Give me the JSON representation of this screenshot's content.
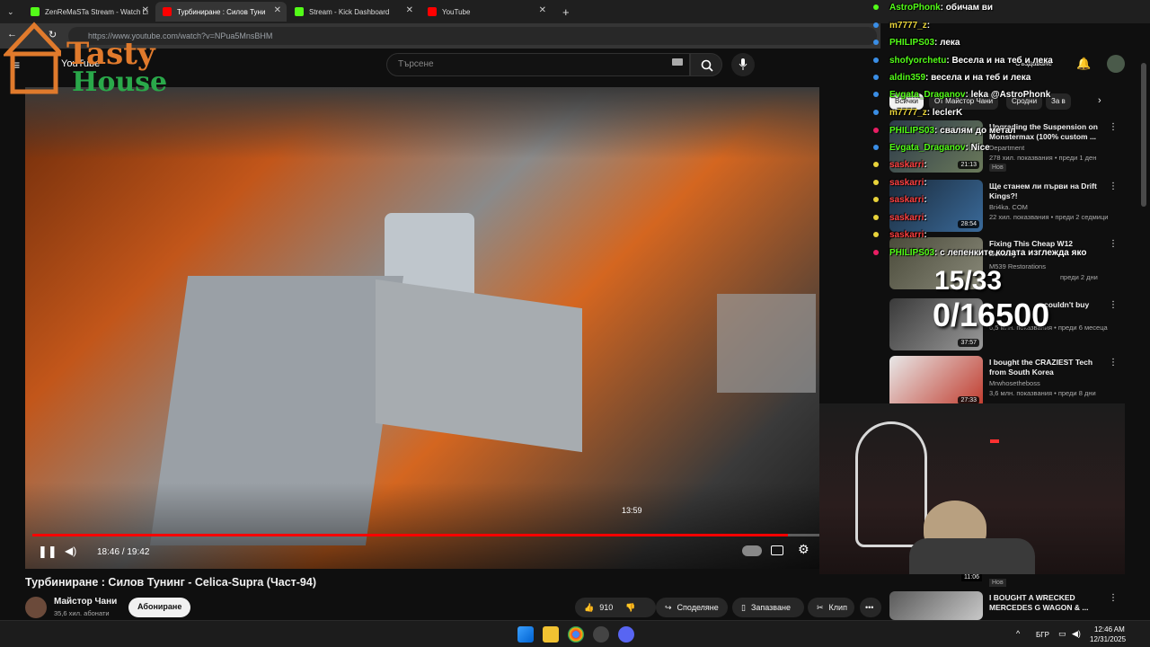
{
  "browser": {
    "tabs": [
      {
        "label": "ZenReMaSTa Stream - Watch Li",
        "color": "#53fc18"
      },
      {
        "label": "Турбиниране : Силов Туни",
        "color": "#ff0000"
      },
      {
        "label": "Stream - Kick Dashboard",
        "color": "#53fc18"
      },
      {
        "label": "YouTube",
        "color": "#ff0000"
      }
    ],
    "url": "https://www.youtube.com/watch?v=NPua5MnsBHM"
  },
  "youtube": {
    "logo_text": "YouTube",
    "search_placeholder": "Търсене",
    "create_label": "Създаване"
  },
  "overlay_logo": {
    "tasty": "Tasty",
    "house": "House"
  },
  "player": {
    "current_time": "18:46 / 19:42",
    "hover_time": "13:59",
    "progress": 0.96
  },
  "video": {
    "title": "Турбиниране : Силов Тунинг - Celica-Supra (Част-94)",
    "channel": "Майстор Чани",
    "subscribers": "35,6 хил. абонати",
    "subscribe_label": "Абониране",
    "likes": "910",
    "share_label": "Споделяне",
    "save_label": "Запазване",
    "clip_label": "Клип"
  },
  "filters": [
    "Всички",
    "От Майстор Чани",
    "Сродни",
    "За в"
  ],
  "recommendations": [
    {
      "title": "Upgrading the Suspension on Monstermax (100% custom ...",
      "channel": "Department",
      "meta": "278 хил. показвания • преди 1 ден",
      "duration": "21:13",
      "badge": "Нов"
    },
    {
      "title": "Ще станем ли първи на Drift Kings?!",
      "channel": "Bri4ka. COM",
      "meta": "22 хил. показвания • преди 2 седмици",
      "duration": "28:54",
      "badge": ""
    },
    {
      "title": "Fixing This Cheap W12 Bentley",
      "channel": "M539 Restorations",
      "meta": "преди 2 дни",
      "duration": "",
      "badge": ""
    },
    {
      "title": "couldn't buy",
      "channel": "",
      "meta": "6,5 млн. показвания • преди 6 месеца",
      "duration": "37:57",
      "badge": ""
    },
    {
      "title": "I bought the CRAZIEST Tech from South Korea",
      "channel": "Mrwhosetheboss",
      "meta": "3,6 млн. показвания • преди 8 дни",
      "duration": "27:33",
      "badge": ""
    },
    {
      "title": "I BOUGHT A WRECKED MERCEDES G WAGON & ...",
      "channel": "",
      "meta": "",
      "duration": "",
      "badge": ""
    }
  ],
  "extra_duration": "11:06",
  "extra_badge": "Нов",
  "chat": [
    {
      "user": "AstroPhonk",
      "msg": ": обичам ви",
      "color": "#53fc18"
    },
    {
      "user": "m7777_z",
      "msg": ":",
      "color": "#e8d33a"
    },
    {
      "user": "PHILIPS03",
      "msg": ": лека",
      "color": "#53fc18"
    },
    {
      "user": "shofyorchetu",
      "msg": ": Весела и на теб и лека",
      "color": "#53fc18"
    },
    {
      "user": "aldin359",
      "msg": ": весела и на теб и лека",
      "color": "#53fc18"
    },
    {
      "user": "Evgata_Draganov",
      "msg": ": leka @AstroPhonk",
      "color": "#53fc18"
    },
    {
      "user": "m7777_z",
      "msg": ": leclerK",
      "color": "#e8d33a"
    },
    {
      "user": "PHILIPS03",
      "msg": ": свалям до метал",
      "color": "#53fc18"
    },
    {
      "user": "Evgata_Draganov",
      "msg": ": Nice",
      "color": "#53fc18"
    },
    {
      "user": "saskarri",
      "msg": ":",
      "color": "#ff4040"
    },
    {
      "user": "saskarri",
      "msg": ":",
      "color": "#ff4040"
    },
    {
      "user": "saskarri",
      "msg": ":",
      "color": "#ff4040"
    },
    {
      "user": "saskarri",
      "msg": ":",
      "color": "#ff4040"
    },
    {
      "user": "saskarri",
      "msg": ":",
      "color": "#ff4040"
    },
    {
      "user": "PHILIPS03",
      "msg": ": с лепенките колата изглежда яко",
      "color": "#53fc18"
    }
  ],
  "sub_goal": {
    "line1": "15/33",
    "line2": "0/16500"
  },
  "taskbar": {
    "lang": "БГР",
    "time": "12:46 AM",
    "date": "12/31/2025"
  }
}
